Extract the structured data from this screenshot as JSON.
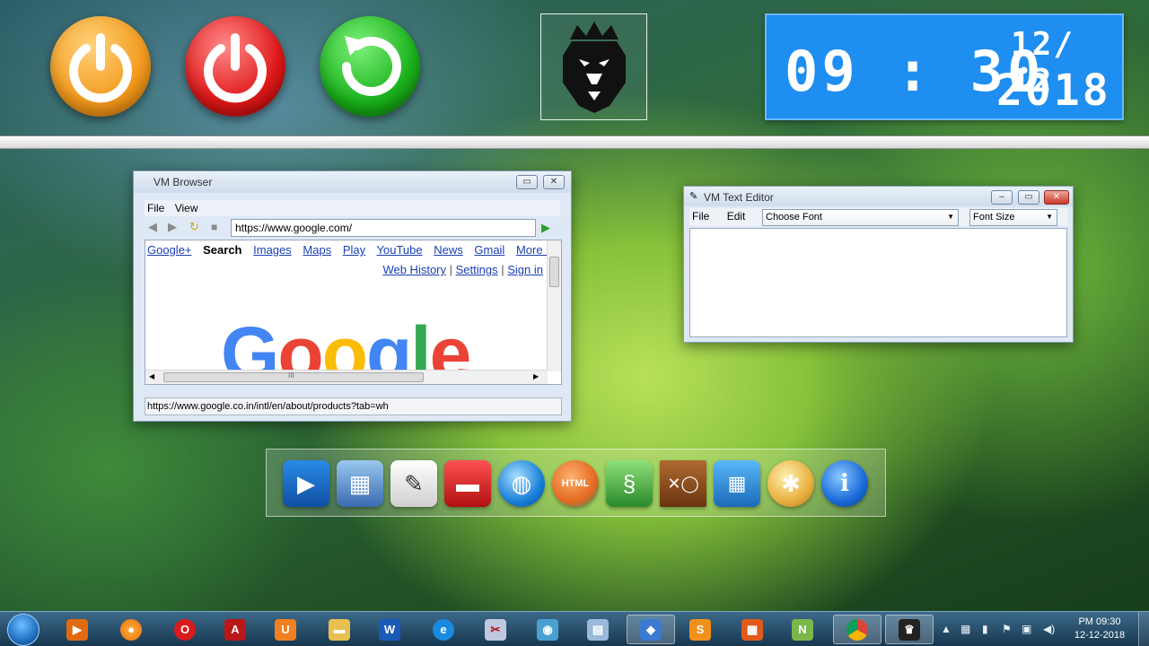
{
  "top_bar": {
    "buttons": [
      {
        "name": "sleep",
        "icon": "power-icon",
        "color": "#f39a1c"
      },
      {
        "name": "shutdown",
        "icon": "power-icon",
        "color": "#e01818"
      },
      {
        "name": "restart",
        "icon": "restart-icon",
        "color": "#1bb21b"
      }
    ],
    "logo_icon": "lion-king-icon",
    "clock": {
      "time": "09 : 30",
      "date_day_month": "12/ 12",
      "date_year": "2018",
      "bg_color": "#1e8ef0"
    }
  },
  "browser": {
    "title": "VM Browser",
    "menu": [
      "File",
      "View"
    ],
    "url": "https://www.google.com/",
    "google_links": [
      "Google+",
      "Search",
      "Images",
      "Maps",
      "Play",
      "YouTube",
      "News",
      "Gmail",
      "More »"
    ],
    "google_links_active": "Search",
    "top_links": [
      "Web History",
      "Settings",
      "Sign in"
    ],
    "logo_text": "Google",
    "hscroll_glyph": "III",
    "status": "https://www.google.co.in/intl/en/about/products?tab=wh"
  },
  "editor": {
    "title": "VM Text Editor",
    "menu": [
      "File",
      "Edit"
    ],
    "font_select": "Choose Font",
    "size_select": "Font Size",
    "content": ""
  },
  "dock": {
    "apps": [
      {
        "name": "video-player",
        "icon": "clapper-icon",
        "color": "#1f6fd0"
      },
      {
        "name": "photo-viewer",
        "icon": "photos-icon",
        "color": "#4a86c8"
      },
      {
        "name": "notepad",
        "icon": "pencil-notepad-icon",
        "color": "#e8e8e8"
      },
      {
        "name": "file-explorer",
        "icon": "folder-icon",
        "color": "#d82020"
      },
      {
        "name": "browser",
        "icon": "globe-icon",
        "color": "#1a7fd8"
      },
      {
        "name": "html-editor",
        "icon": "html-icon",
        "color": "#e46a20"
      },
      {
        "name": "python",
        "icon": "snake-icon",
        "color": "#3aa83a"
      },
      {
        "name": "tic-tac-toe",
        "icon": "tictactoe-icon",
        "color": "#8a4a20"
      },
      {
        "name": "calculator",
        "icon": "calculator-icon",
        "color": "#1a8ad8"
      },
      {
        "name": "paint",
        "icon": "palette-icon",
        "color": "#e8b040"
      },
      {
        "name": "about",
        "icon": "info-icon",
        "color": "#1a6ad8"
      }
    ]
  },
  "taskbar": {
    "apps": [
      {
        "name": "media-player",
        "icon": "play-icon",
        "color": "#e06a10"
      },
      {
        "name": "firefox",
        "icon": "firefox-icon",
        "color": "#e8700a"
      },
      {
        "name": "opera",
        "icon": "opera-icon",
        "color": "#d81a1a"
      },
      {
        "name": "acrobat",
        "icon": "pdf-icon",
        "color": "#b81818"
      },
      {
        "name": "uc-browser",
        "icon": "uc-icon",
        "color": "#f08020"
      },
      {
        "name": "explorer",
        "icon": "folder-icon",
        "color": "#e8c050"
      },
      {
        "name": "word",
        "icon": "word-icon",
        "color": "#1a5ab8"
      },
      {
        "name": "internet-explorer",
        "icon": "ie-icon",
        "color": "#1a8ae0"
      },
      {
        "name": "snipping-tool",
        "icon": "scissors-icon",
        "color": "#c0c8e0"
      },
      {
        "name": "media-center",
        "icon": "media-icon",
        "color": "#4aa0d0"
      },
      {
        "name": "notes",
        "icon": "notes-icon",
        "color": "#9ab8d8"
      },
      {
        "name": "virtualbox",
        "icon": "cube-icon",
        "color": "#3a7ad0"
      },
      {
        "name": "sublime",
        "icon": "sublime-icon",
        "color": "#f0901a"
      },
      {
        "name": "office",
        "icon": "office-icon",
        "color": "#e05a1a"
      },
      {
        "name": "notepad-plus",
        "icon": "notepadpp-icon",
        "color": "#7ab84a"
      },
      {
        "name": "chrome",
        "icon": "chrome-icon",
        "color": "#2a9a3a"
      },
      {
        "name": "vm-os",
        "icon": "lion-icon",
        "color": "#222222"
      }
    ],
    "tray": {
      "time": "PM 09:30",
      "date": "12-12-2018"
    }
  }
}
